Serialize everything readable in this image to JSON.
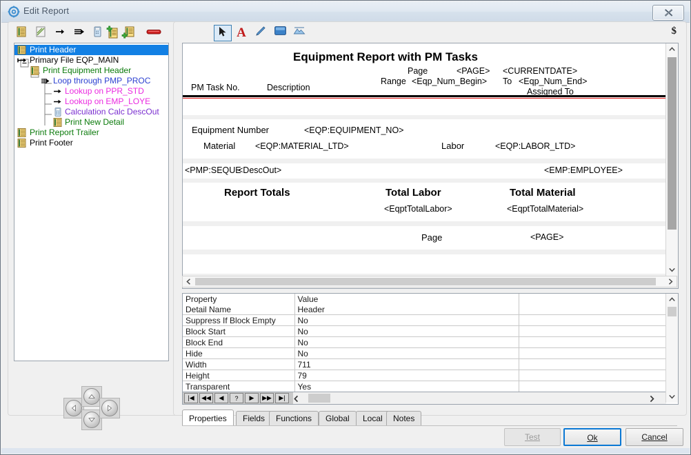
{
  "window": {
    "title": "Edit Report",
    "close_label": "Close"
  },
  "left_toolbar": {
    "items": [
      {
        "name": "report-icon",
        "label": "Report"
      },
      {
        "name": "edit-report-icon",
        "label": "Edit Report"
      },
      {
        "name": "arrow-right-icon",
        "label": "Primary File"
      },
      {
        "name": "loop-icon",
        "label": "Loop"
      },
      {
        "name": "calculation-icon",
        "label": "Calculation"
      },
      {
        "name": "add-detail-icon",
        "label": "Add Detail"
      },
      {
        "name": "add-block-icon",
        "label": "Add Block"
      },
      {
        "name": "delete-icon",
        "label": "Delete"
      }
    ]
  },
  "tree": {
    "items": [
      {
        "label": "Print Header",
        "icon": "detail-icon",
        "color": "selected",
        "indent": 0,
        "selected": true
      },
      {
        "label": "Primary File EQP_MAIN",
        "icon": "arrow-long-icon",
        "color": "black",
        "indent": 0,
        "selected": false
      },
      {
        "label": "Print Equipment Header",
        "icon": "detail-icon",
        "color": "green",
        "indent": 1,
        "selected": false
      },
      {
        "label": "Loop through  PMP_PROC",
        "icon": "loop-icon",
        "color": "blue",
        "indent": 2,
        "selected": false
      },
      {
        "label": "Lookup on PPR_STD",
        "icon": "arrow-right-icon",
        "color": "magenta",
        "indent": 3,
        "selected": false
      },
      {
        "label": "Lookup on EMP_LOYE",
        "icon": "arrow-right-icon",
        "color": "magenta",
        "indent": 3,
        "selected": false
      },
      {
        "label": "Calculation Calc DescOut",
        "icon": "calculation-icon",
        "color": "purple",
        "indent": 3,
        "selected": false
      },
      {
        "label": "Print New Detail",
        "icon": "detail-icon",
        "color": "green",
        "indent": 3,
        "selected": false
      },
      {
        "label": "Print Report Trailer",
        "icon": "detail-icon",
        "color": "green",
        "indent": 0,
        "selected": false
      },
      {
        "label": "Print Footer",
        "icon": "detail-icon",
        "color": "black",
        "indent": 0,
        "selected": false
      }
    ]
  },
  "nav_pad": {
    "up_label": "Move Up",
    "down_label": "Move Down",
    "left_label": "Move Left",
    "right_label": "Move Right"
  },
  "report_toolbar": {
    "tools": [
      {
        "name": "select-arrow-icon",
        "label": "Select",
        "active": true
      },
      {
        "name": "text-icon",
        "label": "Text",
        "active": false
      },
      {
        "name": "pencil-icon",
        "label": "Line",
        "active": false
      },
      {
        "name": "rectangle-icon",
        "label": "Box",
        "active": false
      },
      {
        "name": "image-icon",
        "label": "Image",
        "active": false
      }
    ],
    "currency_symbol": "$"
  },
  "report_canvas": {
    "title": "Equipment Report with PM Tasks",
    "header": {
      "page_label": "Page",
      "page_field": "<PAGE>",
      "currentdate_field": "<CURRENTDATE>",
      "range_label": "Range",
      "range_begin": "<Eqp_Num_Begin>",
      "to_label": "To",
      "range_end": "<Eqp_Num_End>",
      "assigned_to_label": "Assigned To",
      "col_task_no": "PM Task No.",
      "col_description": "Description"
    },
    "equipment_band": {
      "equipment_number_label": "Equipment Number",
      "equipment_number_field": "<EQP:EQUIPMENT_NO>",
      "material_label": "Material",
      "material_field": "<EQP:MATERIAL_LTD>",
      "labor_label": "Labor",
      "labor_field": "<EQP:LABOR_LTD>"
    },
    "detail_band": {
      "sequence_field": "<PMP:SEQUE",
      "descout_field": "<DescOut>",
      "employee_field": "<EMP:EMPLOYEE>"
    },
    "totals_band": {
      "report_totals_label": "Report Totals",
      "total_labor_label": "Total Labor",
      "total_material_label": "Total Material",
      "total_labor_field": "<EqptTotalLabor>",
      "total_material_field": "<EqptTotalMaterial>"
    },
    "footer_band": {
      "page_label": "Page",
      "page_field": "<PAGE>"
    }
  },
  "properties_grid": {
    "columns": [
      "Property",
      "Value",
      ""
    ],
    "rows": [
      [
        "Property",
        "Value",
        ""
      ],
      [
        "Detail Name",
        "Header",
        ""
      ],
      [
        "Suppress If Block Empty",
        "No",
        ""
      ],
      [
        "Block Start",
        "No",
        ""
      ],
      [
        "Block End",
        "No",
        ""
      ],
      [
        "Hide",
        "No",
        ""
      ],
      [
        "Width",
        "711",
        ""
      ],
      [
        "Height",
        "79",
        ""
      ],
      [
        "Transparent",
        "Yes",
        ""
      ]
    ],
    "nav_buttons": [
      {
        "name": "first-record-button",
        "glyph": "|◀"
      },
      {
        "name": "prev-page-button",
        "glyph": "◀◀"
      },
      {
        "name": "prev-record-button",
        "glyph": "◀"
      },
      {
        "name": "help-button",
        "glyph": "?"
      },
      {
        "name": "next-record-button",
        "glyph": "▶"
      },
      {
        "name": "next-page-button",
        "glyph": "▶▶"
      },
      {
        "name": "last-record-button",
        "glyph": "▶|"
      }
    ]
  },
  "tabs": {
    "items": [
      {
        "label": "Properties",
        "active": true
      },
      {
        "label": "Fields",
        "active": false
      },
      {
        "label": "Functions",
        "active": false
      },
      {
        "label": "Global",
        "active": false
      },
      {
        "label": "Local",
        "active": false
      },
      {
        "label": "Notes",
        "active": false
      }
    ]
  },
  "footer": {
    "test_label": "Test",
    "ok_label": "Ok",
    "cancel_label": "Cancel"
  },
  "colors": {
    "selection_blue": "#1280e4",
    "focus_blue": "#0a78d4",
    "tree_green": "#0a7a0a",
    "tree_magenta": "#ea2ae0",
    "tree_blue": "#2a3fd0",
    "tree_purple": "#7a2fd0",
    "rule_red": "#e01b1b"
  }
}
